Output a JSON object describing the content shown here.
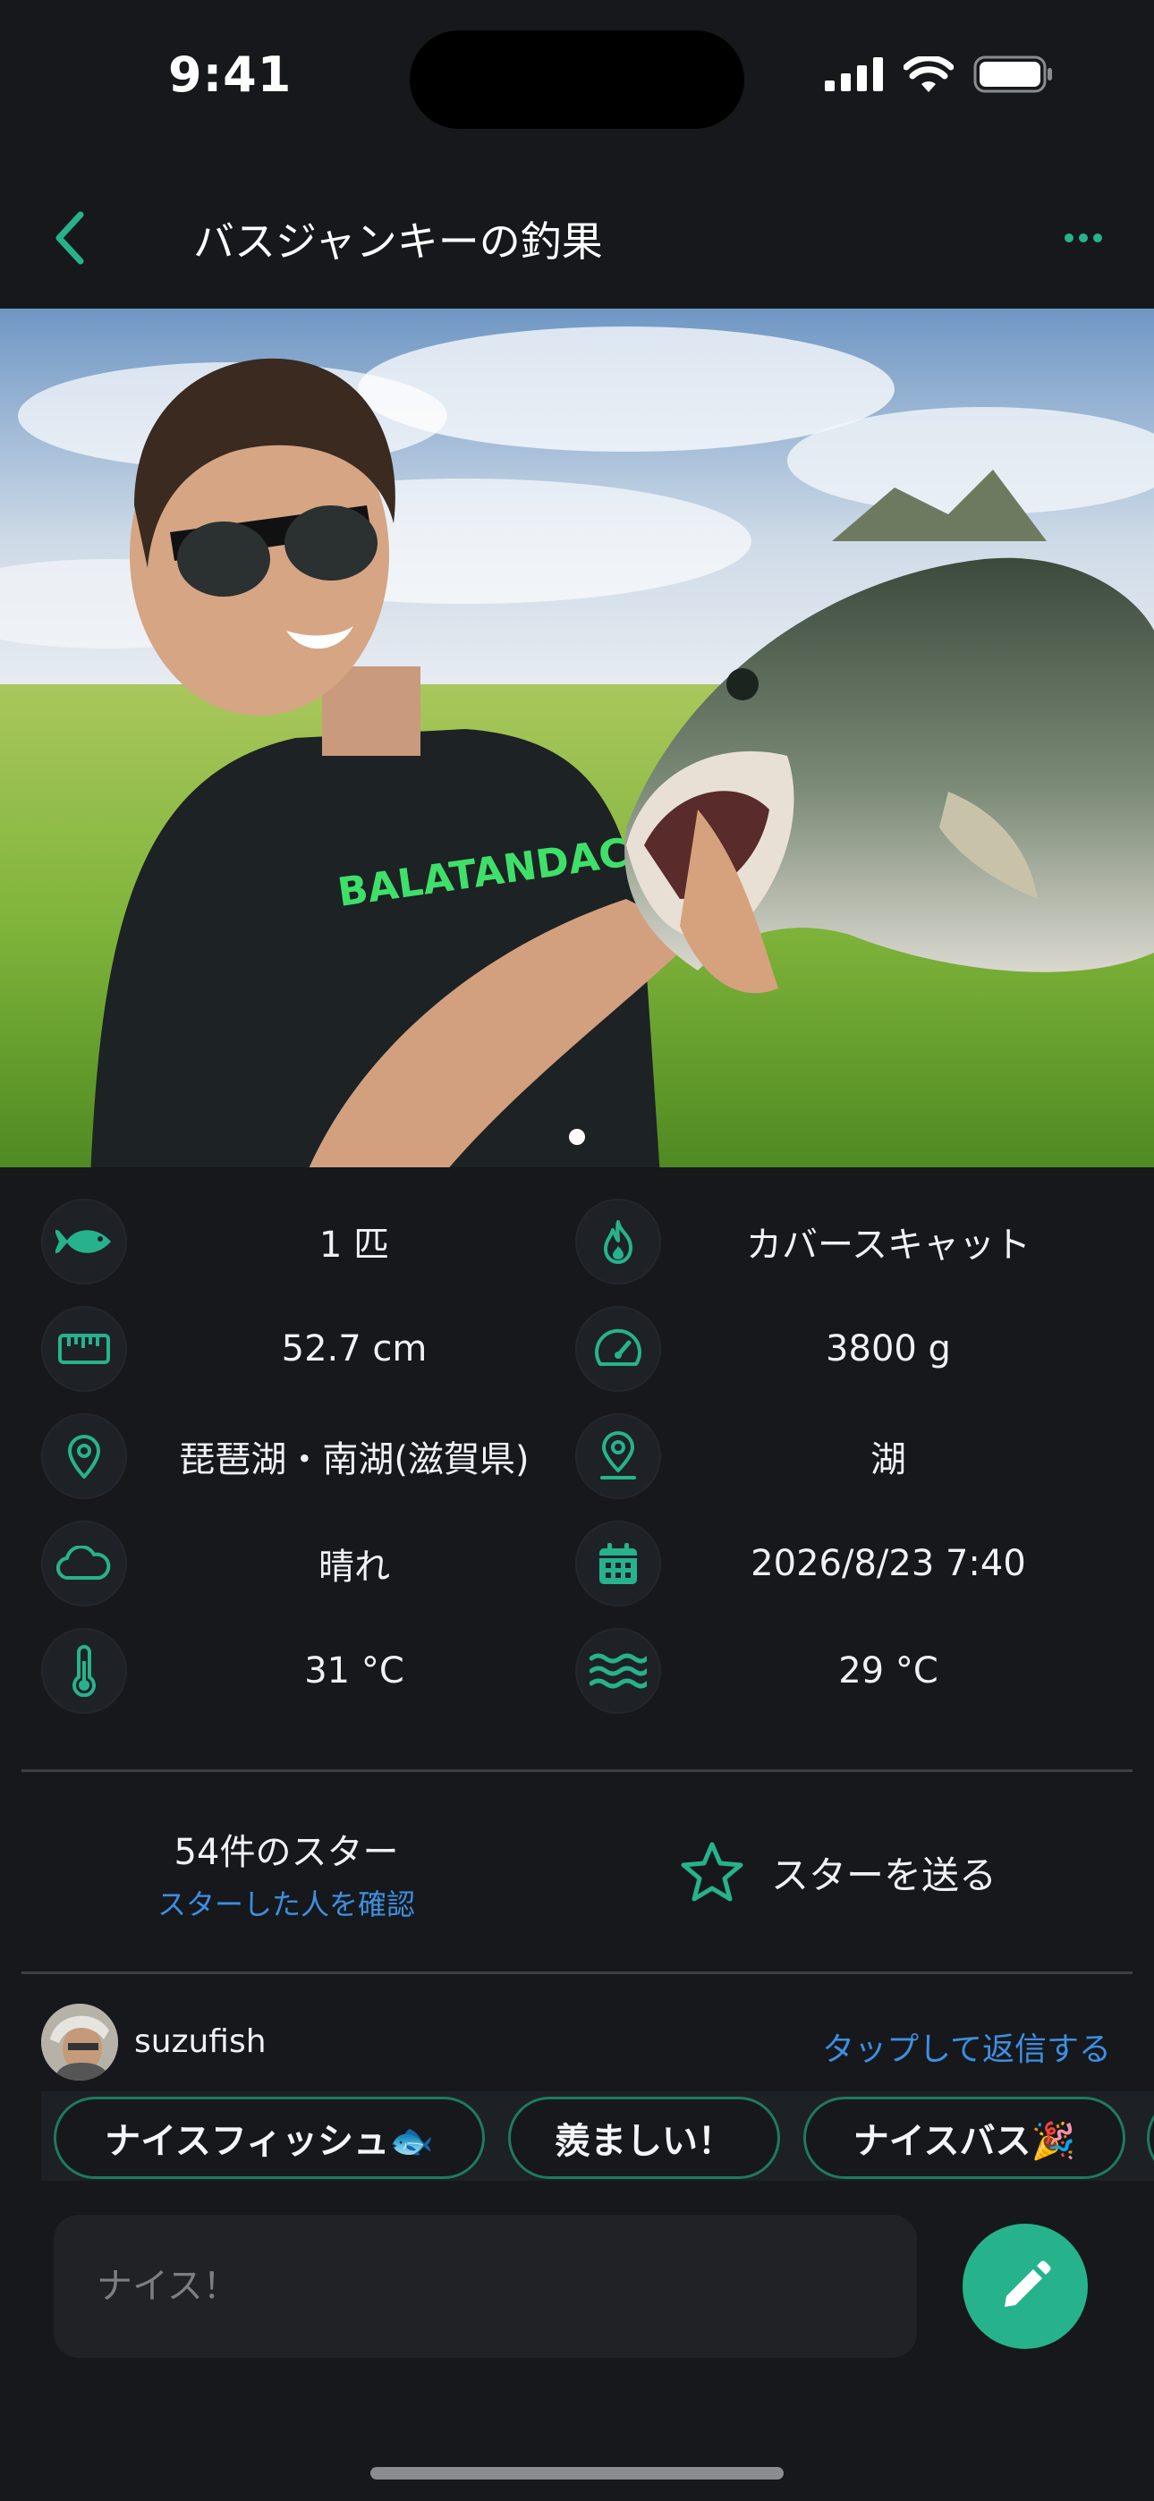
{
  "status_bar": {
    "time": "9:41"
  },
  "nav": {
    "title": "バスジャンキーの釣果",
    "back_icon": "chevron-left-icon",
    "more_icon": "ellipsis-icon"
  },
  "hero": {
    "page_indicator": {
      "current": 1,
      "total": 1
    },
    "printed_text": "BALATANDACA"
  },
  "details": {
    "count": "1 匹",
    "lure": "カバースキャット",
    "length": "52.7 cm",
    "weight": "3800 g",
    "spot": "琵琶湖・南湖(滋賀県)",
    "field_type": "湖",
    "weather": "晴れ",
    "datetime": "2026/8/23 7:40",
    "air_temp": "31 °C",
    "water_temp": "29 °C"
  },
  "stars": {
    "count_label": "54件のスター",
    "see_who_link": "スターした人を確認",
    "send_label": "スターを送る"
  },
  "comment": {
    "username": "suzufish",
    "reply_link": "タップして返信する",
    "chips": [
      "ナイスフィッシュ🐟",
      "羨ましい！",
      "ナイスバス🎉"
    ],
    "input_placeholder": "ナイス！"
  },
  "colors": {
    "accent": "#26b38b",
    "link": "#3d8fe0",
    "background": "#16181c"
  }
}
